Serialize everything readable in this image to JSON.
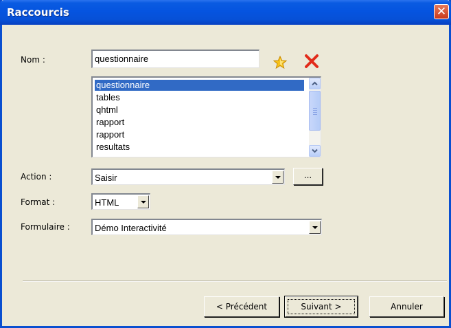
{
  "window": {
    "title": "Raccourcis",
    "close_glyph": "✕"
  },
  "form": {
    "nom_label": "Nom :",
    "nom_value": "questionnaire",
    "favorite_icon": "star-icon",
    "delete_icon": "red-x-icon",
    "list_items": [
      "questionnaire",
      "tables",
      "qhtml",
      "rapport",
      "rapport",
      "resultats"
    ],
    "selected_index": 0,
    "action_label": "Action :",
    "action_value": "Saisir",
    "browse_label": "...",
    "format_label": "Format :",
    "format_value": "HTML",
    "formulaire_label": "Formulaire :",
    "formulaire_value": "Démo Interactivité"
  },
  "buttons": {
    "prev_label": "< Précédent",
    "next_label": "Suivant >",
    "cancel_label": "Annuler"
  },
  "colors": {
    "titlebar": "#0554e0",
    "selection": "#316ac5",
    "dialog_bg": "#ece9d8",
    "close_button": "#c9391b"
  }
}
